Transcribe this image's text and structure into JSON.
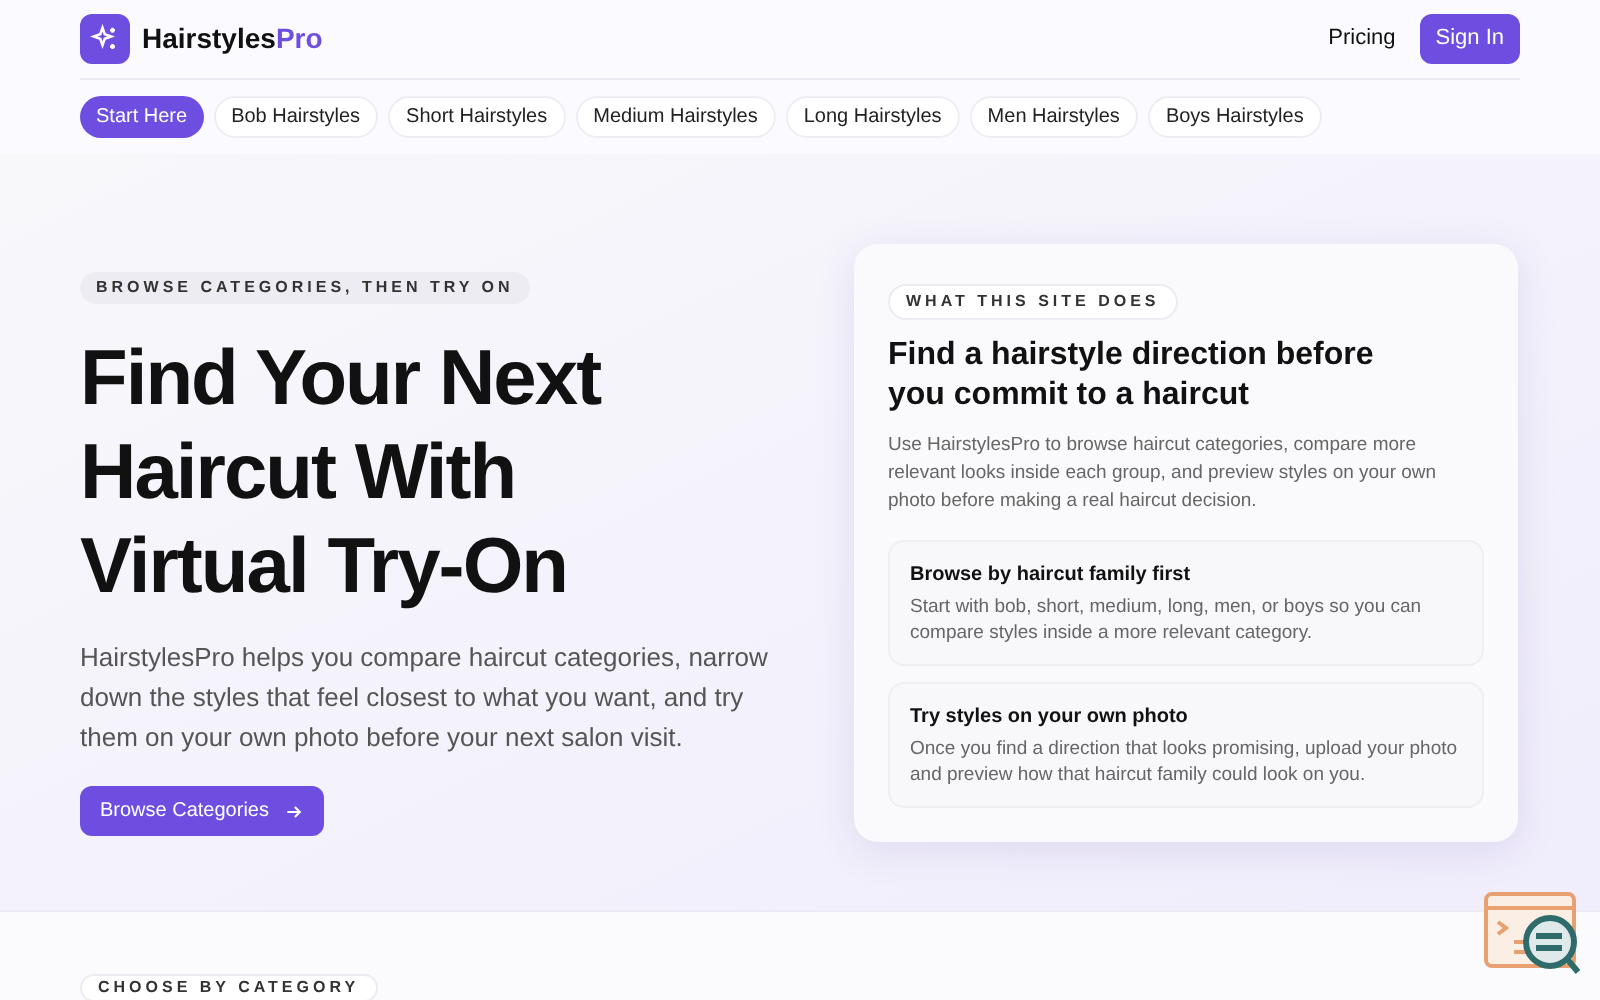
{
  "header": {
    "brand": {
      "name": "Hairstyles",
      "accent": "Pro"
    },
    "links": [
      "Pricing"
    ],
    "cta": "Sign In"
  },
  "categories": [
    {
      "label": "Start Here",
      "selected": true
    },
    {
      "label": "Bob Hairstyles",
      "selected": false
    },
    {
      "label": "Short Hairstyles",
      "selected": false
    },
    {
      "label": "Medium Hairstyles",
      "selected": false
    },
    {
      "label": "Long Hairstyles",
      "selected": false
    },
    {
      "label": "Men Hairstyles",
      "selected": false
    },
    {
      "label": "Boys Hairstyles",
      "selected": false
    }
  ],
  "hero": {
    "eyebrow": "BROWSE CATEGORIES, THEN TRY ON",
    "title": [
      "Find Your Next",
      "Haircut With",
      "Virtual Try-On"
    ],
    "text": "HairstylesPro helps you compare haircut categories, narrow down the styles that feel closest to what you want, and try them on your own photo before your next salon visit.",
    "button": "Browse Categories"
  },
  "info_card": {
    "eyebrow": "WHAT THIS SITE DOES",
    "title": "Find a hairstyle direction before you commit to a haircut",
    "text": "Use HairstylesPro to browse haircut categories, compare more relevant looks inside each group, and preview styles on your own photo before making a real haircut decision.",
    "steps": [
      {
        "title": "Browse by haircut family first",
        "text": "Start with bob, short, medium, long, men, or boys so you can compare styles inside a more relevant category."
      },
      {
        "title": "Try styles on your own photo",
        "text": "Once you find a direction that looks promising, upload your photo and preview how that haircut family could look on you."
      }
    ]
  },
  "next_section": {
    "eyebrow": "CHOOSE BY CATEGORY"
  }
}
